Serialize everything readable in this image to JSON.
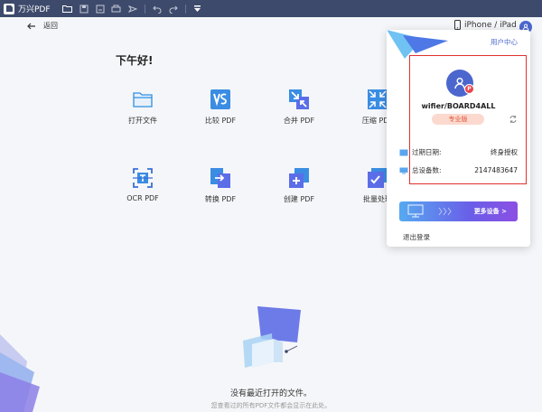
{
  "titlebar": {
    "app_name": "万兴PDF"
  },
  "toprow": {
    "back_label": "返回",
    "device_label": "iPhone / iPad"
  },
  "main": {
    "greeting": "下午好!",
    "tools": [
      {
        "label": "打开文件",
        "icon": "folder-icon"
      },
      {
        "label": "比较 PDF",
        "icon": "compare-icon"
      },
      {
        "label": "合并 PDF",
        "icon": "merge-icon"
      },
      {
        "label": "压缩 PDF",
        "icon": "compress-icon"
      },
      {
        "label": "OCR PDF",
        "icon": "ocr-icon"
      },
      {
        "label": "转换 PDF",
        "icon": "convert-icon"
      },
      {
        "label": "创建 PDF",
        "icon": "create-icon"
      },
      {
        "label": "批量处理",
        "icon": "batch-icon"
      }
    ],
    "empty_title": "没有最近打开的文件。",
    "empty_subtitle": "您查看过的所有PDF文件都会显示在此处。"
  },
  "popup": {
    "user_center": "用户中心",
    "avatar_badge": "P",
    "username": "wifier/BOARD4ALL",
    "edition": "专业版",
    "expiry_label": "过期日期:",
    "expiry_value": "终身授权",
    "devices_label": "总设备数:",
    "devices_value": "2147483647",
    "more_devices": "更多设备 >",
    "logout": "退出登录"
  },
  "colors": {
    "titlebar": "#3d4a6b",
    "accent": "#4b67ce",
    "highlight": "#e0322e"
  }
}
